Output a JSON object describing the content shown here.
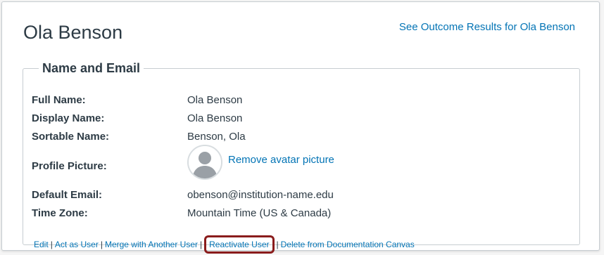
{
  "header": {
    "title": "Ola Benson",
    "outcome_link": "See Outcome Results for Ola Benson"
  },
  "section": {
    "legend": "Name and Email",
    "fields": {
      "full_name_label": "Full Name:",
      "full_name_value": "Ola Benson",
      "display_name_label": "Display Name:",
      "display_name_value": "Ola Benson",
      "sortable_name_label": "Sortable Name:",
      "sortable_name_value": "Benson, Ola",
      "profile_picture_label": "Profile Picture:",
      "remove_avatar_link": "Remove avatar picture",
      "default_email_label": "Default Email:",
      "default_email_value": "obenson@institution-name.edu",
      "time_zone_label": "Time Zone:",
      "time_zone_value": "Mountain Time (US & Canada)"
    }
  },
  "actions": {
    "edit": "Edit",
    "act_as_user": "Act as User",
    "merge": "Merge with Another User",
    "reactivate": "Reactivate User",
    "delete": "Delete from Documentation Canvas",
    "separator": "|"
  },
  "icons": {
    "avatar": "default-avatar-icon"
  },
  "colors": {
    "link": "#0374b5",
    "text": "#2d3b45",
    "highlight_border": "#8a1c1c"
  }
}
